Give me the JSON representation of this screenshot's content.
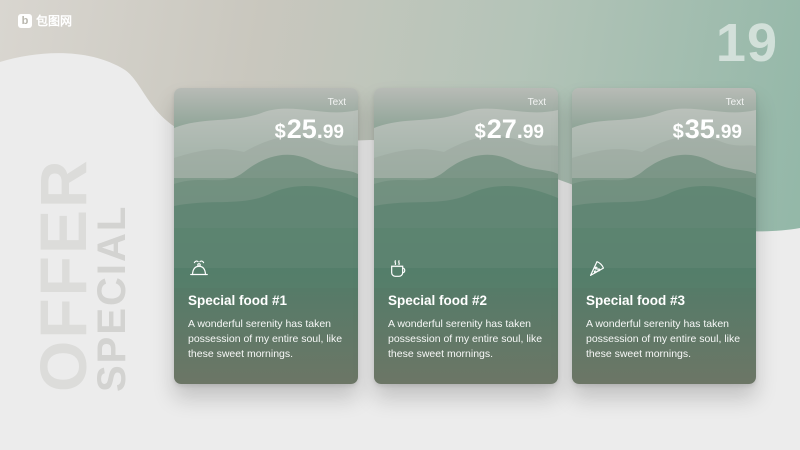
{
  "brand": {
    "mark": "b",
    "name": "包图网"
  },
  "page_number": "19",
  "vertical_title": {
    "line1": "SPECIAL",
    "line2": "OFFER"
  },
  "colors": {
    "accent_green": "#4d7d69",
    "card_bottom": "#6c7666",
    "background_light": "#ececec"
  },
  "cards": [
    {
      "tag": "Text",
      "price": {
        "currency": "$",
        "whole": "25",
        "dot": ".",
        "fraction": "99"
      },
      "icon": "cloche-icon",
      "title": "Special food #1",
      "description": "A wonderful serenity has taken possession of my entire soul, like these sweet mornings."
    },
    {
      "tag": "Text",
      "price": {
        "currency": "$",
        "whole": "27",
        "dot": ".",
        "fraction": "99"
      },
      "icon": "coffee-cup-icon",
      "title": "Special food #2",
      "description": "A wonderful serenity has taken possession of my entire soul, like these sweet mornings."
    },
    {
      "tag": "Text",
      "price": {
        "currency": "$",
        "whole": "35",
        "dot": ".",
        "fraction": "99"
      },
      "icon": "pizza-slice-icon",
      "title": "Special food #3",
      "description": "A wonderful serenity has taken possession of my entire soul, like these sweet mornings."
    }
  ]
}
